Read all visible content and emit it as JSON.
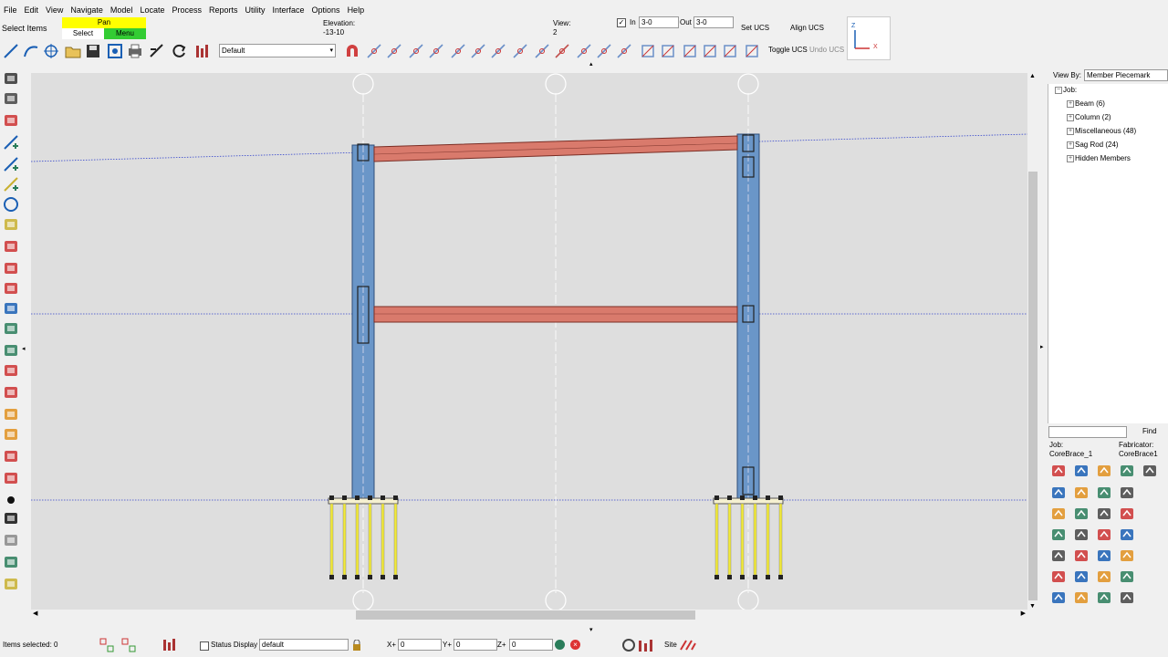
{
  "menu": [
    "File",
    "Edit",
    "View",
    "Navigate",
    "Model",
    "Locate",
    "Process",
    "Reports",
    "Utility",
    "Interface",
    "Options",
    "Help"
  ],
  "toolbar": {
    "select_items": "Select Items",
    "pan_label": "Pan",
    "select_label": "Select",
    "menu_label": "Menu",
    "view_combo": "Default",
    "elevation_label": "Elevation:",
    "elevation_value": "-13-10",
    "view_label": "View:",
    "view_value": "2",
    "in_label": "In",
    "in_value": "3-0",
    "out_label": "Out",
    "out_value": "3-0",
    "set_ucs": "Set UCS",
    "align_ucs": "Align UCS",
    "toggle_ucs": "Toggle UCS",
    "undo_ucs": "Undo UCS",
    "axis_z": "Z",
    "axis_x": "X",
    "colors": {
      "pan_bg": "#ffff00",
      "menu_bg": "#33cc33"
    }
  },
  "drawing": {
    "background": "#dedede",
    "beam_color": "#d97a6c",
    "column_color": "#6a96c8",
    "rod_color": "#f2ea3a"
  },
  "right_panel": {
    "view_by_label": "View By:",
    "view_by_value": "Member Piecemark",
    "tree_root": "Job:",
    "tree_items": [
      "Beam (6)",
      "Column (2)",
      "Miscellaneous (48)",
      "Sag Rod (24)",
      "Hidden Members"
    ],
    "find_label": "Find",
    "job_label": "Job:",
    "job_value": "CoreBrace_1",
    "fabricator_label": "Fabricator:",
    "fabricator_value": "CoreBrace1"
  },
  "status": {
    "items_selected": "Items selected: 0",
    "status_display": "Status Display",
    "status_combo": "default",
    "x_label": "X+",
    "x_value": "0",
    "y_label": "Y+",
    "y_value": "0",
    "z_label": "Z+",
    "z_value": "0",
    "site_label": "Site"
  }
}
